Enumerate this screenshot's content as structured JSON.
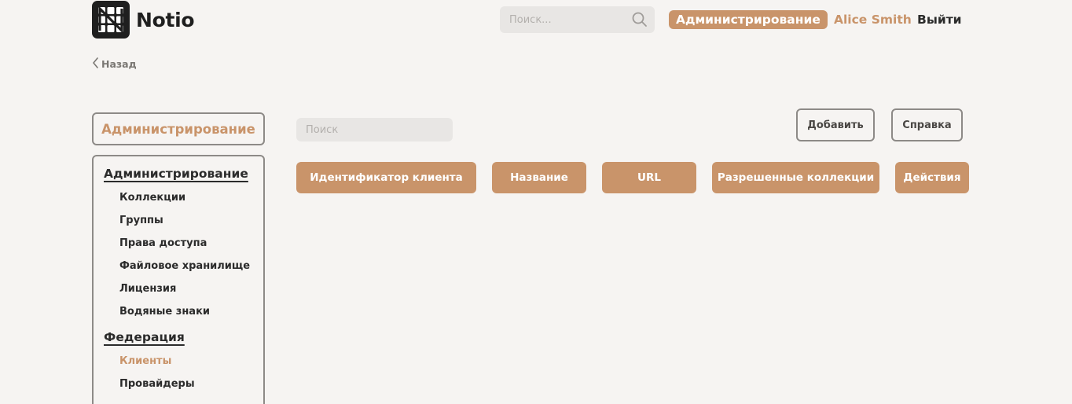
{
  "header": {
    "logo_text": "Notio",
    "search_placeholder": "Поиск...",
    "nav_admin": "Администрирование",
    "user_name": "Alice Smith",
    "logout": "Выйти"
  },
  "back": {
    "label": "Назад"
  },
  "sidebar": {
    "title": "Администрирование",
    "groups": [
      {
        "label": "Администрирование",
        "items": [
          {
            "label": "Коллекции"
          },
          {
            "label": "Группы"
          },
          {
            "label": "Права доступа"
          },
          {
            "label": "Файловое хранилище"
          },
          {
            "label": "Лицензия"
          },
          {
            "label": "Водяные знаки"
          }
        ]
      },
      {
        "label": "Федерация",
        "items": [
          {
            "label": "Клиенты",
            "active": true
          },
          {
            "label": "Провайдеры"
          }
        ]
      }
    ]
  },
  "main": {
    "search_placeholder": "Поиск",
    "add_button": "Добавить",
    "help_button": "Справка",
    "columns": [
      "Идентификатор клиента",
      "Название",
      "URL",
      "Разрешенные коллекции",
      "Действия"
    ]
  },
  "colors": {
    "accent": "#c9946a",
    "background": "#f6f4f2",
    "border": "#8d8a87",
    "input_bg": "#e8e6e4",
    "text": "#2b2b2b"
  }
}
